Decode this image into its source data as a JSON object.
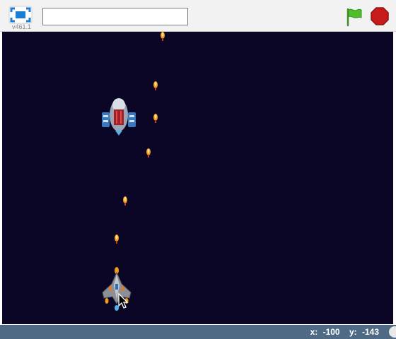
{
  "toolbar": {
    "version": "v461.1",
    "project_title_value": "",
    "presentation_mode_icon": "fullscreen-icon",
    "green_flag_icon": "green-flag-icon",
    "stop_icon": "stop-sign-icon",
    "flag_color": "#4cbf2b",
    "stop_color": "#c81b1b"
  },
  "stage": {
    "background_color": "#0b0625",
    "sprites": [
      "enemy-ship",
      "player-ship",
      "bullet",
      "mouse-cursor"
    ]
  },
  "status": {
    "x_label": "x:",
    "x_value": "-100",
    "y_label": "y:",
    "y_value": "-143"
  }
}
